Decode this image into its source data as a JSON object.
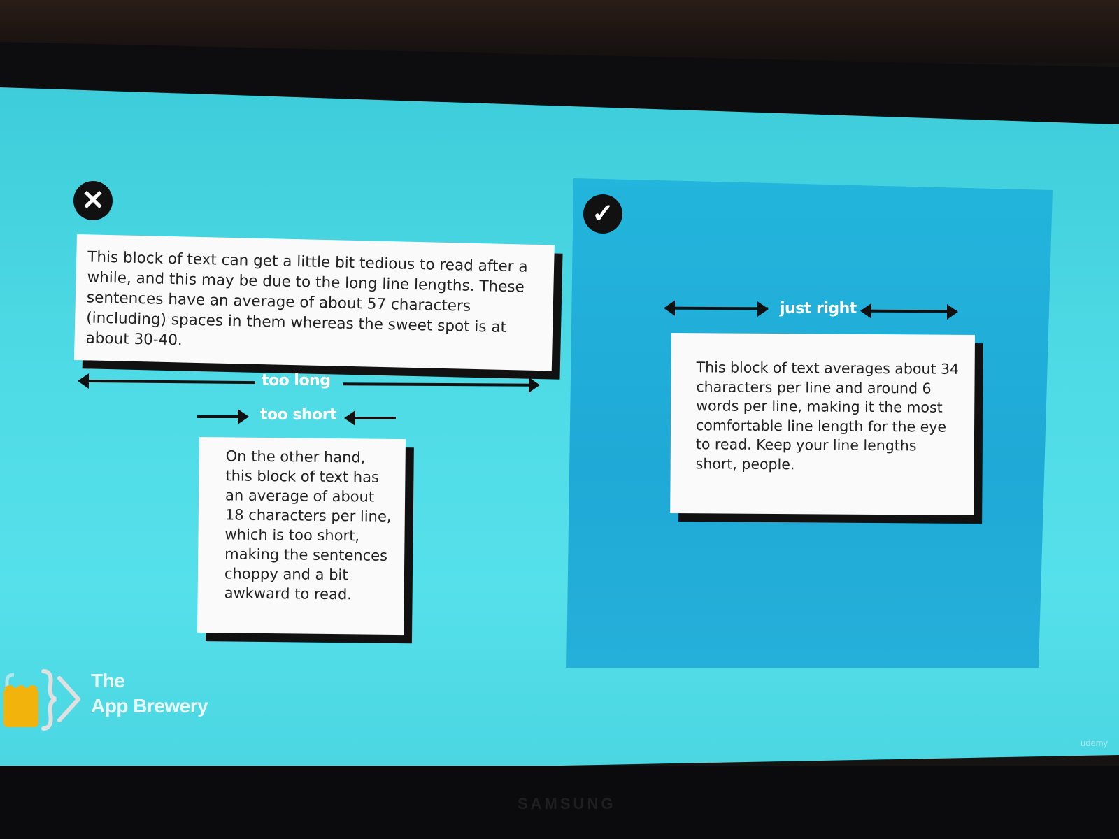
{
  "slide": {
    "bad_icon": "✕",
    "good_icon": "✓",
    "long_block": {
      "text": "This block of text can get a little bit tedious to read after a while, and this may be due to the long line lengths. These sentences have an average of about 57 characters (including) spaces in them whereas the sweet spot is at about 30-40.",
      "label": "too long"
    },
    "short_block": {
      "label": "too short",
      "text": "On the other hand, this block of text has an average of about 18 characters per line, which is too short, making the sentences choppy and a bit awkward to read."
    },
    "right_block": {
      "label": "just right",
      "text": "This block of text averages about 34 characters per line and around 6 words per line, making it the most comfortable line length for the eye to read. Keep your line lengths short, people."
    }
  },
  "logo": {
    "line1": "The",
    "line2": "App Brewery"
  },
  "watermark": "udemy",
  "monitor_brand": "SAMSUNG",
  "colors": {
    "screen_bg": "#4fdbe6",
    "panel_bg": "#23b5dc",
    "card_bg": "#fafafa",
    "shadow": "#111111",
    "logo_yellow": "#f2b40c"
  }
}
